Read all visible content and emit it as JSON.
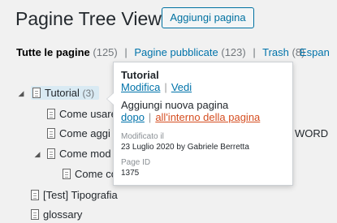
{
  "header": {
    "title": "Pagine Tree View",
    "add_button": "Aggiungi pagina"
  },
  "views": {
    "all_label": "Tutte le pagine",
    "all_count": "(125)",
    "published_label": "Pagine pubblicate",
    "published_count": "(123)",
    "trash_label": "Trash",
    "trash_count": "(8)",
    "separator": "|",
    "expand_label": "Espan"
  },
  "tree": {
    "toggle_expanded": "◢",
    "items": [
      {
        "label": "Tutorial",
        "count": "(3)"
      },
      {
        "label": "Come usare"
      },
      {
        "label": "Come aggi"
      },
      {
        "label": "Come mod"
      },
      {
        "label": "Come co"
      },
      {
        "label": "[Test] Tipografia"
      },
      {
        "label": "glossary"
      }
    ],
    "overflow_text": "WORD"
  },
  "popup": {
    "title": "Tutorial",
    "edit_link": "Modifica",
    "view_link": "Vedi",
    "add_new_text": "Aggiungi nuova pagina",
    "after_link": "dopo",
    "inside_link": "all'interno della pagina",
    "modified_label": "Modificato il",
    "modified_value": "23 Luglio 2020 by Gabriele Berretta",
    "page_id_label": "Page ID",
    "page_id_value": "1375"
  }
}
